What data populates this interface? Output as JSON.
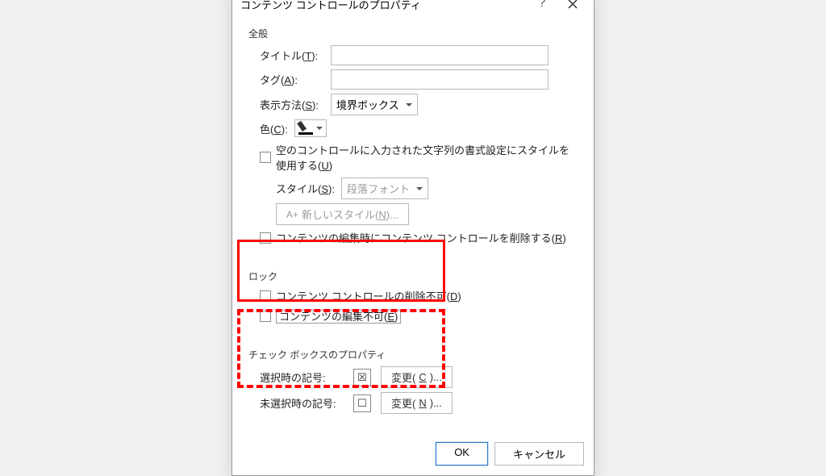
{
  "title": "コンテンツ コントロールのプロパティ",
  "help_glyph": "?",
  "general": {
    "legend": "全般",
    "title_label_pre": "タイトル(",
    "title_label_u": "T",
    "title_label_post": "):",
    "title_value": "",
    "tag_label_pre": "タグ(",
    "tag_label_u": "A",
    "tag_label_post": "):",
    "tag_value": "",
    "show_label_pre": "表示方法(",
    "show_label_u": "S",
    "show_label_post": "):",
    "show_value": "境界ボックス",
    "color_label_pre": "色(",
    "color_label_u": "C",
    "color_label_post": "):",
    "use_style_pre": "空のコントロールに入力された文字列の書式設定にスタイルを使用する(",
    "use_style_u": "U",
    "use_style_post": ")",
    "style_label_pre": "スタイル(",
    "style_label_u": "S",
    "style_label_post": "):",
    "style_value": "段落フォント",
    "newstyle_pre": "新しいスタイル(",
    "newstyle_u": "N",
    "newstyle_post": ")...",
    "aplus": "A+",
    "remove_on_edit_pre": "コンテンツの編集時にコンテンツ コントロールを削除する(",
    "remove_on_edit_u": "R",
    "remove_on_edit_post": ")"
  },
  "lock": {
    "legend": "ロック",
    "no_delete_pre": "コンテンツ コントロールの削除不可(",
    "no_delete_u": "D",
    "no_delete_post": ")",
    "no_edit_pre": "コンテンツの編集不可(",
    "no_edit_u": "E",
    "no_edit_post": ")"
  },
  "cbprops": {
    "legend": "チェック ボックスのプロパティ",
    "checked_label": "選択時の記号:",
    "checked_symbol": "☒",
    "change1_pre": "変更(",
    "change1_u": "C",
    "change1_post": ")...",
    "unchecked_label": "未選択時の記号:",
    "unchecked_symbol": "☐",
    "change2_pre": "変更(",
    "change2_u": "N",
    "change2_post": ")..."
  },
  "footer": {
    "ok": "OK",
    "cancel": "キャンセル"
  }
}
